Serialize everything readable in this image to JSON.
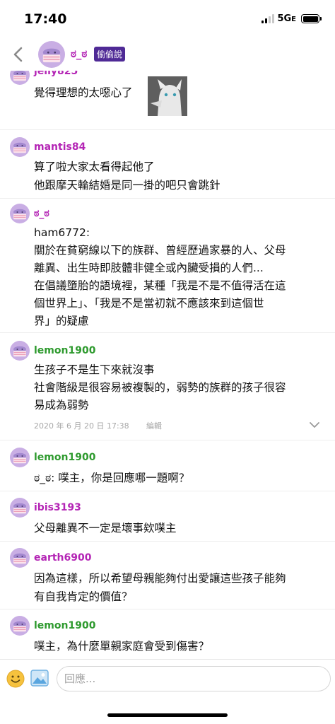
{
  "status_bar": {
    "time": "17:40",
    "network": "5G",
    "network_suffix": "E"
  },
  "header": {
    "title": "ಠ_ಠ",
    "badge": "偷偷說"
  },
  "messages": [
    {
      "user": "jelly825",
      "lines": [
        "覺得理想的太噁心了"
      ],
      "has_sticker": true
    },
    {
      "user": "mantis84",
      "lines": [
        "算了啦大家太看得起他了",
        "他跟摩天輪結婚是同一掛的吧只會跳針"
      ]
    },
    {
      "user": "ಠ_ಠ",
      "lines": [
        "ham6772:",
        "關於在貧窮線以下的族群、曾經歷過家暴的人、父母",
        "離異、出生時即肢體非健全或內臟受損的人們...",
        "在倡議墮胎的語境裡，某種「我是不是不值得活在這",
        "個世界上」、「我是不是當初就不應該來到這個世",
        "界」的疑慮"
      ]
    },
    {
      "user": "lemon1900",
      "lines": [
        "生孩子不是生下來就沒事",
        "社會階級是很容易被複製的，弱勢的族群的孩子很容",
        "易成為弱勢"
      ],
      "timestamp": "2020 年 6 月 20 日 17:38",
      "edit_label": "編輯"
    },
    {
      "user": "lemon1900",
      "lines": [
        "ಠ_ಠ: 噗主，你是回應哪一題啊？"
      ]
    },
    {
      "user": "ibis3193",
      "lines": [
        "父母離異不一定是壞事欸噗主"
      ]
    },
    {
      "user": "earth6900",
      "lines": [
        "因為這樣，所以希望母親能夠付出愛讓這些孩子能夠",
        "有自我肯定的價值？"
      ]
    },
    {
      "user": "lemon1900",
      "lines": [
        "噗主，為什麼單親家庭會受到傷害？"
      ]
    }
  ],
  "composer": {
    "placeholder": "回應..."
  },
  "icons": {
    "back": "chevron-left-icon",
    "emoji": "smiley-icon",
    "image": "image-icon",
    "expand": "chevron-down-icon"
  },
  "colors": {
    "username_purple": "#b425b5",
    "username_green": "#2e9a2e",
    "badge_bg": "#4f2a96"
  }
}
